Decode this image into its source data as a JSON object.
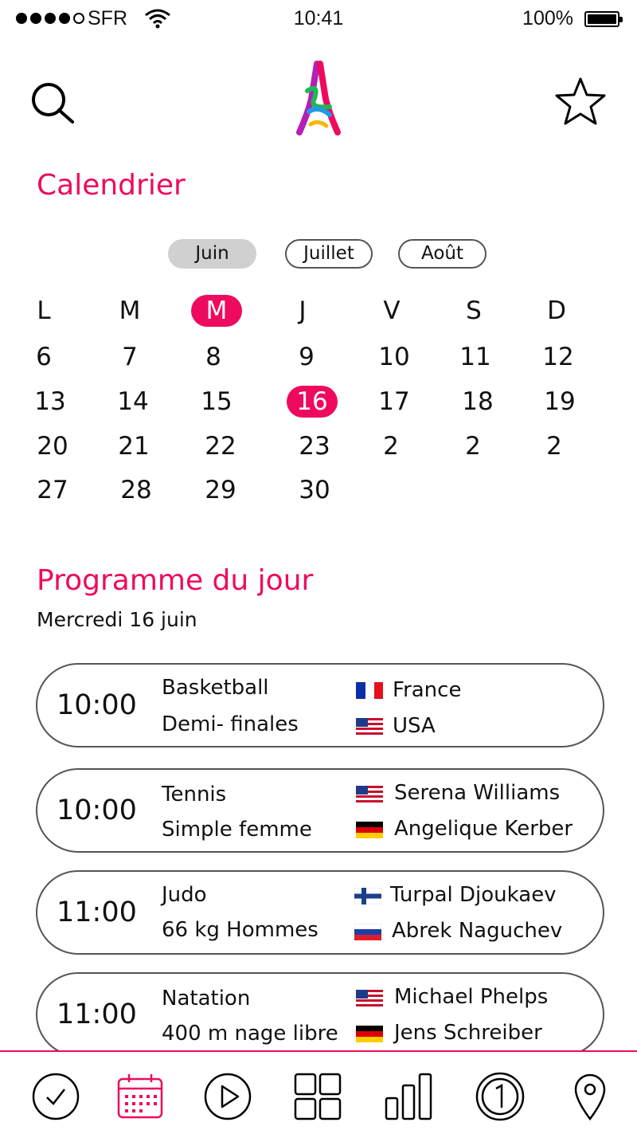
{
  "status_bar": {
    "carrier": "SFR",
    "time": "10:41",
    "battery": "100%"
  },
  "header": {
    "search_icon": "search-icon",
    "logo": "paris-2024-logo",
    "favorites_icon": "star-icon"
  },
  "calendar": {
    "title": "Calendrier",
    "months": [
      "Juin",
      "Juillet",
      "Août"
    ],
    "active_month": "Juin",
    "weekdays": [
      "L",
      "M",
      "M",
      "J",
      "V",
      "S",
      "D"
    ],
    "selected_weekday": "M",
    "weeks": [
      [
        "6",
        "7",
        "8",
        "9",
        "10",
        "11",
        "12"
      ],
      [
        "13",
        "14",
        "15",
        "16",
        "17",
        "18",
        "19"
      ],
      [
        "20",
        "21",
        "22",
        "23",
        "2",
        "2",
        "2"
      ],
      [
        "27",
        "28",
        "29",
        "30",
        "",
        "",
        ""
      ]
    ],
    "selected_day": "16"
  },
  "programme": {
    "title": "Programme du jour",
    "date": "Mercredi 16 juin",
    "events": [
      {
        "time": "10:00",
        "sport": "Basketball",
        "stage": "Demi- finales",
        "competitors": [
          {
            "name": "France",
            "flag": "france"
          },
          {
            "name": "USA",
            "flag": "usa"
          }
        ]
      },
      {
        "time": "10:00",
        "sport": "Tennis",
        "stage": "Simple femme",
        "competitors": [
          {
            "name": "Serena Williams",
            "flag": "usa"
          },
          {
            "name": "Angelique Kerber",
            "flag": "germany"
          }
        ]
      },
      {
        "time": "11:00",
        "sport": "Judo",
        "stage": "66 kg Hommes",
        "competitors": [
          {
            "name": "Turpal Djoukaev",
            "flag": "finland"
          },
          {
            "name": "Abrek Naguchev",
            "flag": "russia"
          }
        ]
      },
      {
        "time": "11:00",
        "sport": "Natation",
        "stage": "400 m nage libre",
        "competitors": [
          {
            "name": "Michael Phelps",
            "flag": "usa"
          },
          {
            "name": "Jens Schreiber",
            "flag": "germany"
          }
        ]
      }
    ]
  },
  "tabbar": {
    "tabs": [
      "check-icon",
      "calendar-icon",
      "play-icon",
      "grid-icon",
      "stats-icon",
      "medal-icon",
      "location-icon"
    ],
    "active": "calendar-icon",
    "accent": "#ee0a5f"
  }
}
